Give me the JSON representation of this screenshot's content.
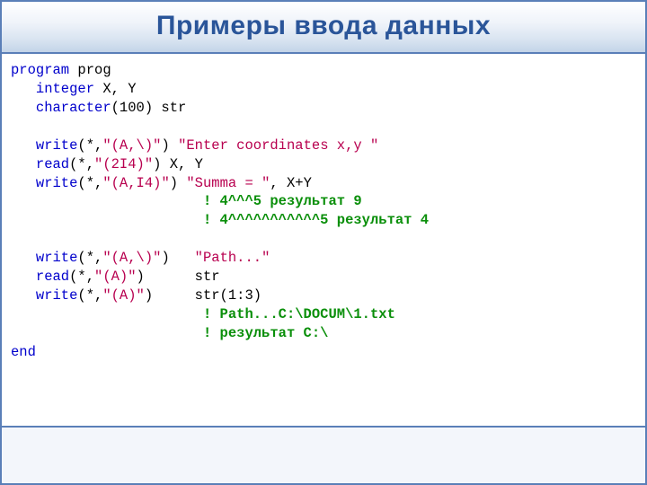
{
  "title": "Примеры ввода данных",
  "code": {
    "l1_kw": "program",
    "l1_id": " prog",
    "l2_kw": "   integer",
    "l2_rest": " X, Y",
    "l3_kw": "   character",
    "l3_rest": "(100) str",
    "blank1": " ",
    "l5_kw": "   write",
    "l5_p1": "(*,",
    "l5_fmt": "\"(A,\\)\"",
    "l5_p2": ") ",
    "l5_str": "\"Enter coordinates x,y \"",
    "l6_kw": "   read",
    "l6_p1": "(*,",
    "l6_fmt": "\"(2I4)\"",
    "l6_p2": ") X, Y",
    "l7_kw": "   write",
    "l7_p1": "(*,",
    "l7_fmt": "\"(A,I4)\"",
    "l7_p2": ") ",
    "l7_str": "\"Summa = \"",
    "l7_rest": ", X+Y",
    "l8_pad": "                       ",
    "l8_cmt": "! 4^^^5 результат 9",
    "l9_pad": "                       ",
    "l9_cmt": "! 4^^^^^^^^^^^5 результат 4",
    "blank2": " ",
    "l11_kw": "   write",
    "l11_p1": "(*,",
    "l11_fmt": "\"(A,\\)\"",
    "l11_p2": ")   ",
    "l11_str": "\"Path...\"",
    "l12_kw": "   read",
    "l12_p1": "(*,",
    "l12_fmt": "\"(A)\"",
    "l12_p2": ")      str",
    "l13_kw": "   write",
    "l13_p1": "(*,",
    "l13_fmt": "\"(A)\"",
    "l13_p2": ")     str(1:3)",
    "l14_pad": "                       ",
    "l14_cmt": "! Path...C:\\DOCUM\\1.txt",
    "l15_pad": "                       ",
    "l15_cmt": "! результат C:\\",
    "l16_kw": "end"
  }
}
